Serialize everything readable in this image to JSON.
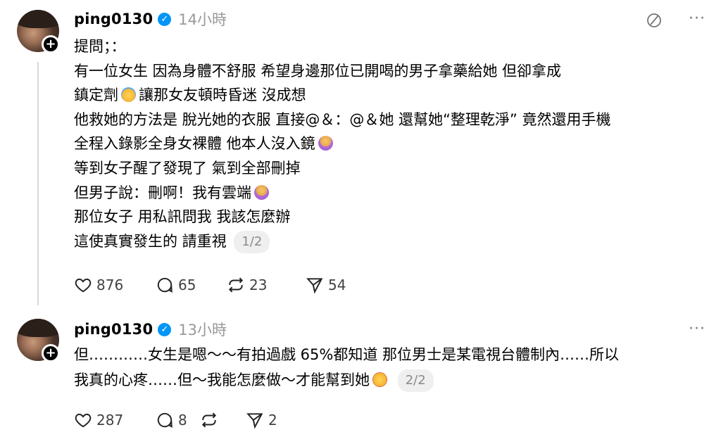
{
  "posts": [
    {
      "username": "ping0130",
      "time": "14小時",
      "text_lines": [
        "提問；：",
        "有一位女生 因為身體不舒服 希望身邊那位已開喝的男子拿藥給她 但卻拿成",
        "鎮定劑",
        "讓那女友頓時昏迷 沒成想",
        "他救她的方法是 脫光她的衣服 直接@＆：@＆她 還幫她“整理乾淨” 竟然還用手機",
        "全程入錄影全身女裸體 他本人沒入鏡",
        "等到女子醒了發現了 氣到全部刪掉",
        "但男子說：刪啊！我有雲端",
        "那位女子 用私訊問我 我該怎麼辦",
        "這使真實發生的 請重視"
      ],
      "page": "1/2",
      "likes": "876",
      "replies": "65",
      "reposts": "23",
      "shares": "54",
      "icons": {
        "emoji_1": "face-screaming-emoji",
        "emoji_2": "person-shrugging-emoji",
        "emoji_3": "person-shrugging-emoji"
      }
    },
    {
      "username": "ping0130",
      "time": "13小時",
      "text_lines": [
        "但…………女生是嗯～～有拍過戲 65%都知道 那位男士是某電視台體制內……所以",
        "我真的心疼……但～我能怎麼做～才能幫到她"
      ],
      "page": "2/2",
      "likes": "287",
      "replies": "8",
      "reposts": "",
      "shares": "2",
      "icons": {
        "emoji_1": "crying-face-emoji"
      }
    }
  ],
  "colors": {
    "verified": "#0095f6",
    "muted_text": "#999999",
    "thread_line": "#d9d9d9"
  }
}
